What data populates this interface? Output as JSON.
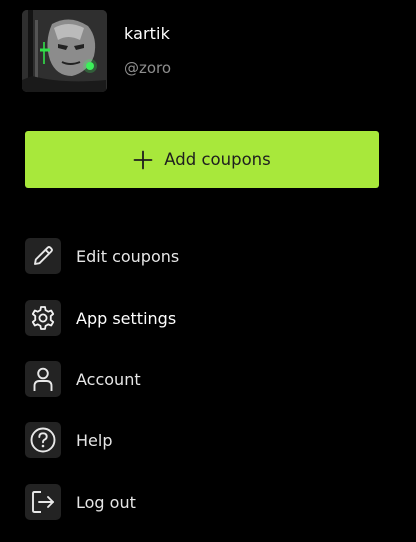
{
  "profile": {
    "name": "kartik",
    "handle": "@zoro"
  },
  "actions": {
    "add_coupons_label": "Add coupons"
  },
  "menu": {
    "items": [
      {
        "label": "Edit coupons",
        "icon": "pencil-icon"
      },
      {
        "label": "App settings",
        "icon": "gear-icon"
      },
      {
        "label": "Account",
        "icon": "user-icon"
      },
      {
        "label": "Help",
        "icon": "help-circle-icon"
      },
      {
        "label": "Log out",
        "icon": "logout-icon"
      }
    ]
  },
  "colors": {
    "background": "#000000",
    "accent": "#a8e83b",
    "text_primary": "#ffffff",
    "text_secondary": "#8e8e8e"
  }
}
